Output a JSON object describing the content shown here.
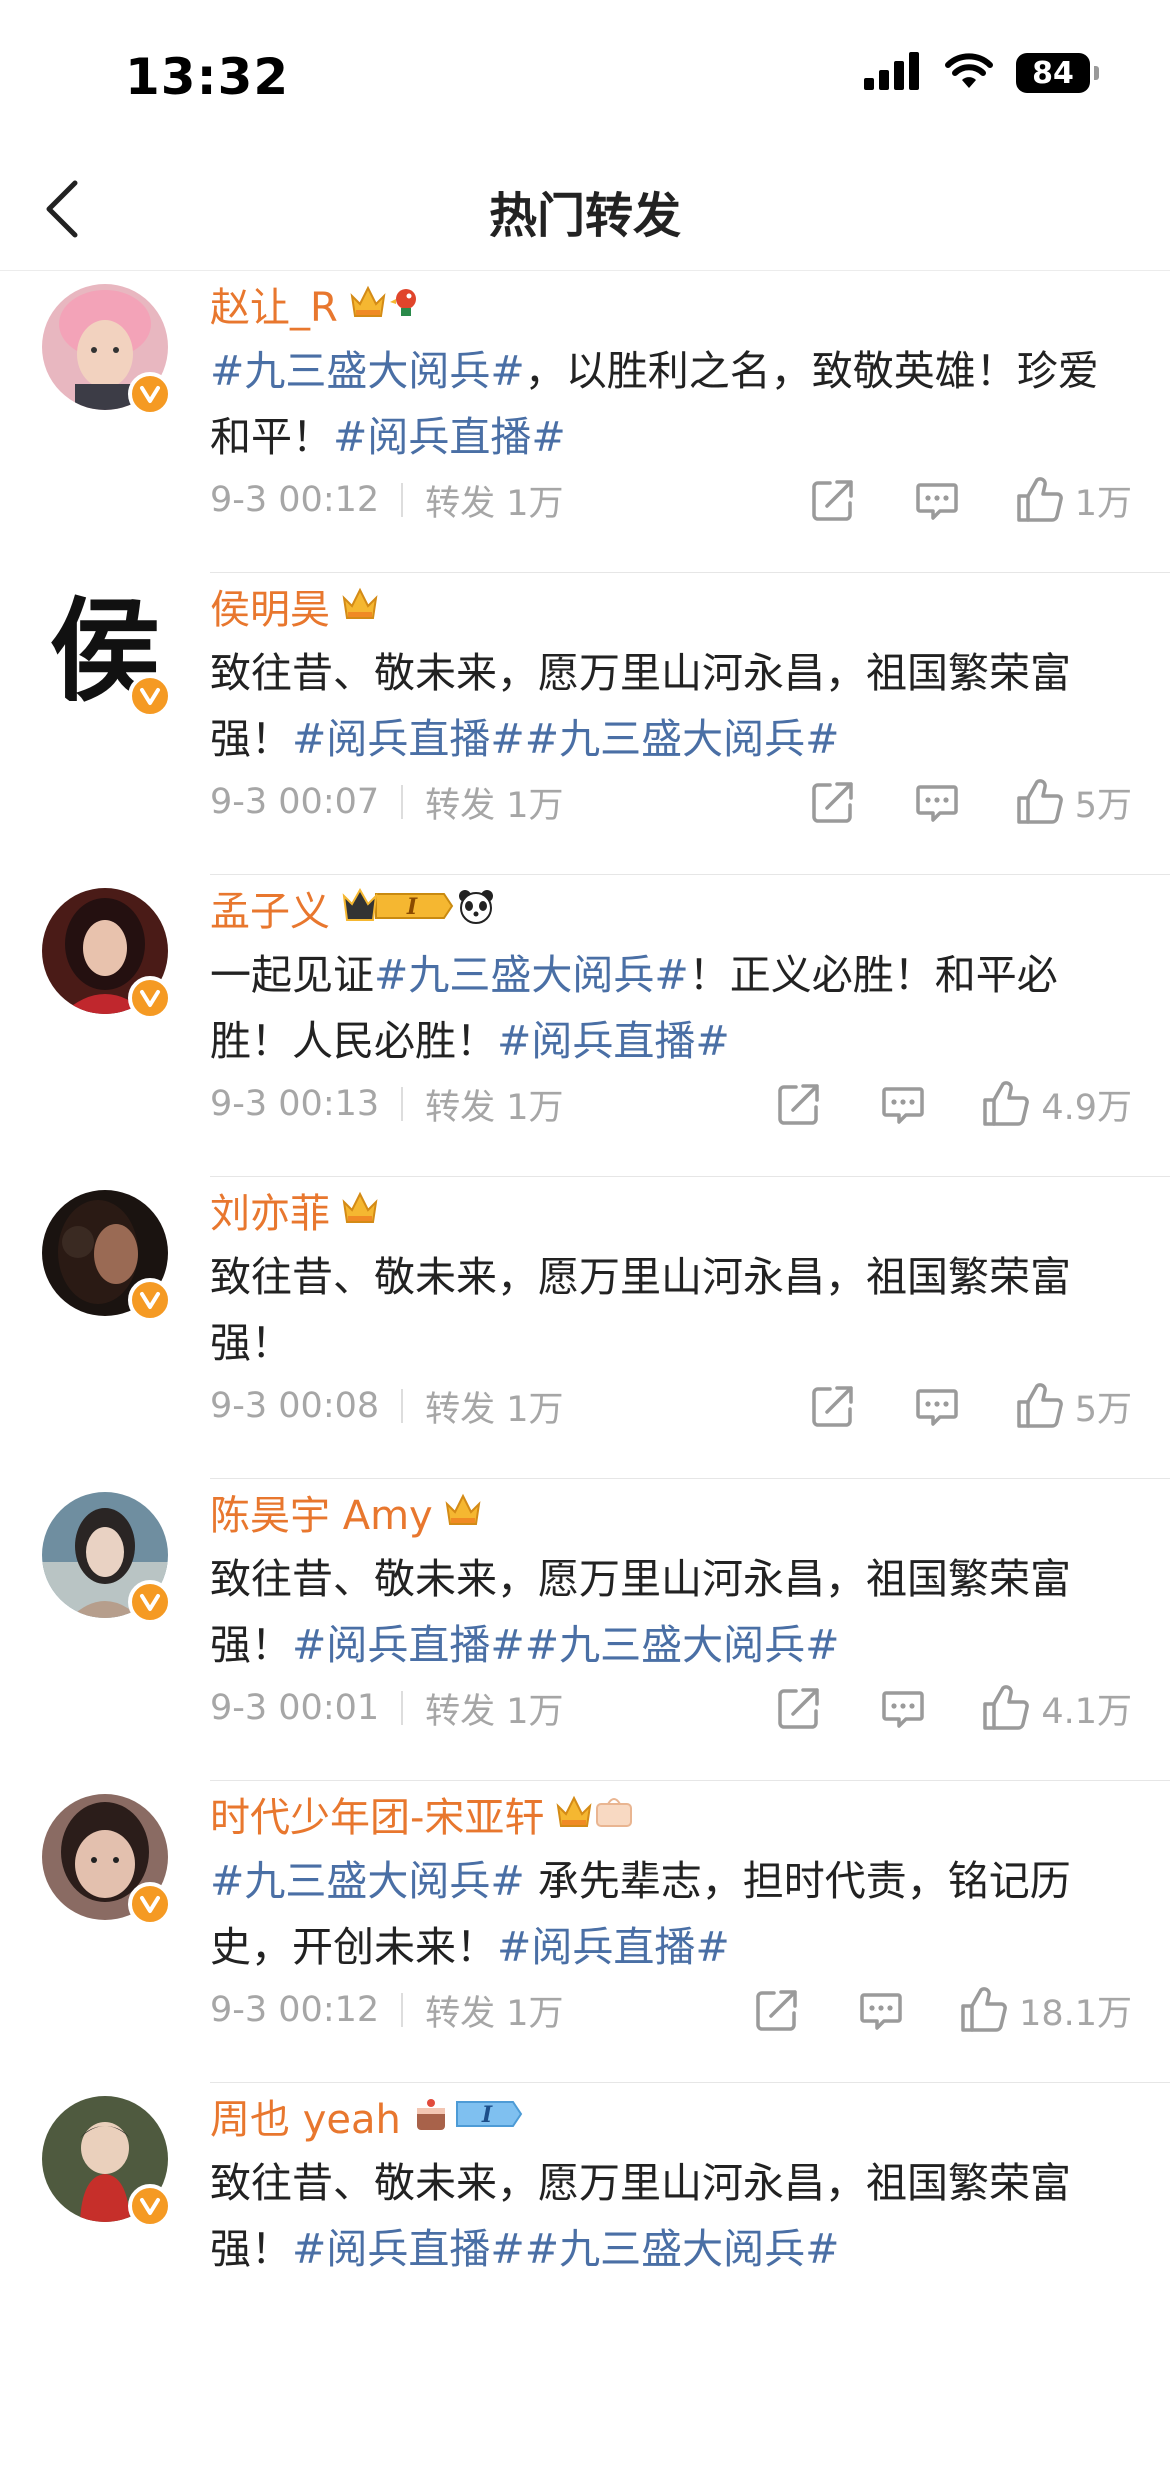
{
  "status_bar": {
    "time": "13:32",
    "battery": "84"
  },
  "header": {
    "title": "热门转发"
  },
  "posts": [
    {
      "username": "赵让_R",
      "text": [
        {
          "tag": "#九三盛大阅兵#"
        },
        {
          "t": "，以胜利之名，致敬英雄！珍爱和平！"
        },
        {
          "tag": "#阅兵直播#"
        }
      ],
      "time": "9-3 00:12",
      "repost": "转发 1万",
      "likes": "1万"
    },
    {
      "username": "侯明昊",
      "avatar_char": "侯",
      "text": [
        {
          "t": "致往昔、敬未来，愿万里山河永昌，祖国繁荣富强！"
        },
        {
          "tag": "#阅兵直播#"
        },
        {
          "tag": "#九三盛大阅兵#"
        }
      ],
      "time": "9-3 00:07",
      "repost": "转发 1万",
      "likes": "5万"
    },
    {
      "username": "孟子义",
      "level": "I",
      "text": [
        {
          "t": "一起见证"
        },
        {
          "tag": "#九三盛大阅兵#"
        },
        {
          "t": "！正义必胜！和平必胜！人民必胜！"
        },
        {
          "tag": "#阅兵直播#"
        }
      ],
      "time": "9-3 00:13",
      "repost": "转发 1万",
      "likes": "4.9万"
    },
    {
      "username": "刘亦菲",
      "text": [
        {
          "t": "致往昔、敬未来，愿万里山河永昌，祖国繁荣富强！"
        }
      ],
      "time": "9-3 00:08",
      "repost": "转发 1万",
      "likes": "5万"
    },
    {
      "username": "陈昊宇 Amy",
      "text": [
        {
          "t": "致往昔、敬未来，愿万里山河永昌，祖国繁荣富强！"
        },
        {
          "tag": "#阅兵直播#"
        },
        {
          "tag": "#九三盛大阅兵#"
        }
      ],
      "time": "9-3 00:01",
      "repost": "转发 1万",
      "likes": "4.1万"
    },
    {
      "username": "时代少年团-宋亚轩",
      "text": [
        {
          "tag": "#九三盛大阅兵#"
        },
        {
          "t": " 承先辈志，担时代责，铭记历史，开创未来！"
        },
        {
          "tag": "#阅兵直播#"
        }
      ],
      "time": "9-3 00:12",
      "repost": "转发 1万",
      "likes": "18.1万"
    },
    {
      "username": "周也 yeah",
      "level": "I",
      "text": [
        {
          "t": "致往昔、敬未来，愿万里山河永昌，祖国繁荣富强！"
        },
        {
          "tag": "#阅兵直播#"
        },
        {
          "tag": "#九三盛大阅兵#"
        }
      ],
      "time": "",
      "repost": "",
      "likes": ""
    }
  ],
  "colors": {
    "username": "#e8772e",
    "hashtag": "#4a6fa5",
    "meta": "#a6a6a6",
    "verified_badge": "#f59a23"
  },
  "icons": {
    "back": "chevron-left-icon",
    "share": "share-icon",
    "comment": "comment-icon",
    "like": "thumbs-up-icon"
  }
}
